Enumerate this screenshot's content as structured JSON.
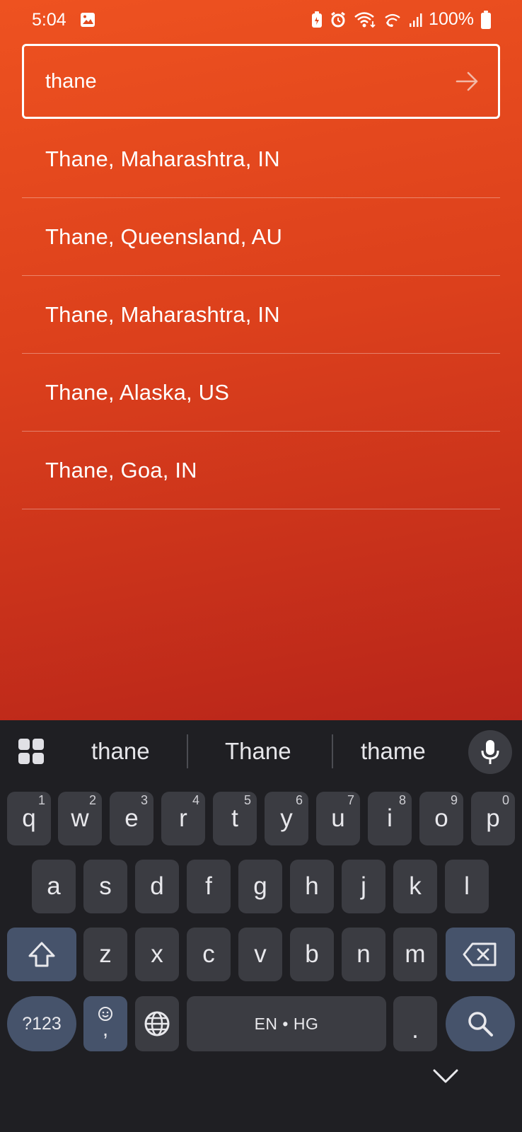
{
  "status": {
    "time": "5:04",
    "battery": "100%"
  },
  "search": {
    "query": "thane"
  },
  "results": [
    "Thane, Maharashtra, IN",
    "Thane, Queensland, AU",
    "Thane, Maharashtra, IN",
    "Thane, Alaska, US",
    "Thane, Goa, IN"
  ],
  "keyboard": {
    "suggestions": [
      "thane",
      "Thane",
      "thame"
    ],
    "row1": [
      {
        "k": "q",
        "h": "1"
      },
      {
        "k": "w",
        "h": "2"
      },
      {
        "k": "e",
        "h": "3"
      },
      {
        "k": "r",
        "h": "4"
      },
      {
        "k": "t",
        "h": "5"
      },
      {
        "k": "y",
        "h": "6"
      },
      {
        "k": "u",
        "h": "7"
      },
      {
        "k": "i",
        "h": "8"
      },
      {
        "k": "o",
        "h": "9"
      },
      {
        "k": "p",
        "h": "0"
      }
    ],
    "row2": [
      "a",
      "s",
      "d",
      "f",
      "g",
      "h",
      "j",
      "k",
      "l"
    ],
    "row3": [
      "z",
      "x",
      "c",
      "v",
      "b",
      "n",
      "m"
    ],
    "symbols_label": "?123",
    "comma_label": ",",
    "space_label": "EN • HG",
    "period_label": ".",
    "icons": {
      "menu": "grid-icon",
      "mic": "mic-icon",
      "shift": "shift-icon",
      "backspace": "backspace-icon",
      "emoji": "emoji-icon",
      "globe": "globe-icon",
      "search": "search-icon",
      "collapse": "chevron-down-icon"
    }
  },
  "colors": {
    "app_gradient_top": "#ee5220",
    "app_gradient_bottom": "#b8251a",
    "keyboard_bg": "#1f1f23",
    "key_bg": "#3b3c42",
    "mod_key_bg": "#46536b"
  }
}
